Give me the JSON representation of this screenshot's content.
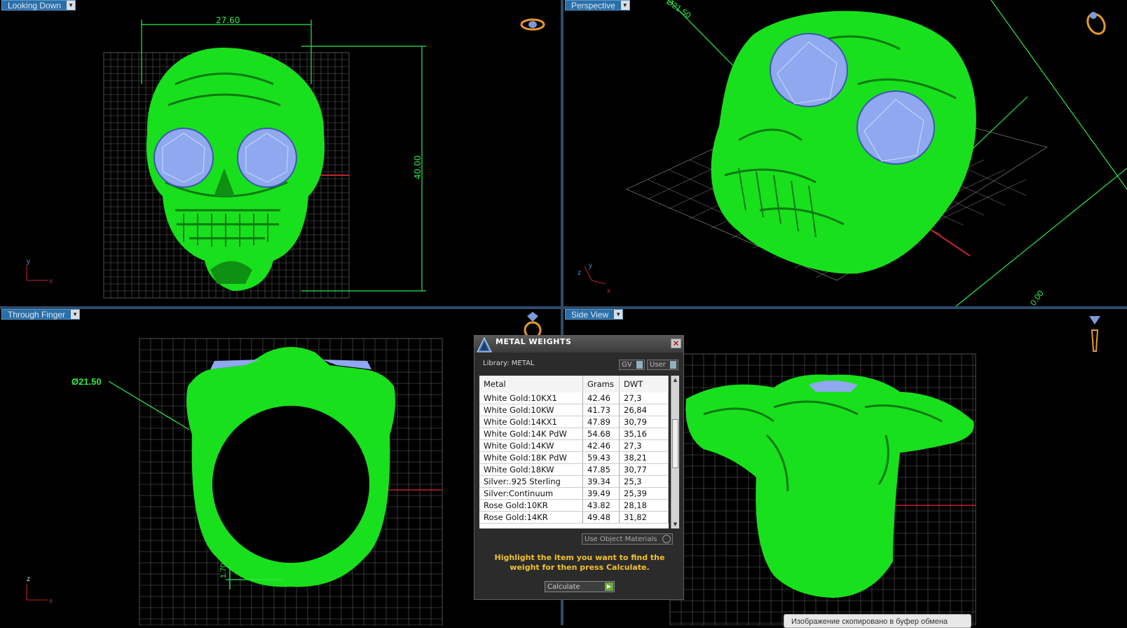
{
  "viewports": [
    {
      "id": "looking-down",
      "label": "Looking Down",
      "width_label": "27.60",
      "height_label": "40.00"
    },
    {
      "id": "perspective",
      "label": "Perspective",
      "dim_label": "Ø21.50",
      "dim_label2": "0.00"
    },
    {
      "id": "through-finger",
      "label": "Through Finger",
      "diameter_label": "Ø21.50",
      "thickness_label": "1.70"
    },
    {
      "id": "side-view",
      "label": "Side View"
    }
  ],
  "axes": {
    "x": "x",
    "y": "y",
    "z": "z"
  },
  "panel": {
    "title": "METAL WEIGHTS",
    "library_label": "Library: METAL",
    "gv_label": "GV",
    "user_label": "User",
    "columns": [
      "Metal",
      "Grams",
      "DWT"
    ],
    "rows": [
      {
        "metal": "White Gold:10KX1",
        "grams": "42.46",
        "dwt": "27,3"
      },
      {
        "metal": "White Gold:10KW",
        "grams": "41.73",
        "dwt": "26,84"
      },
      {
        "metal": "White Gold:14KX1",
        "grams": "47.89",
        "dwt": "30,79"
      },
      {
        "metal": "White Gold:14K PdW",
        "grams": "54.68",
        "dwt": "35,16"
      },
      {
        "metal": "White Gold:14KW",
        "grams": "42.46",
        "dwt": "27,3"
      },
      {
        "metal": "White Gold:18K PdW",
        "grams": "59.43",
        "dwt": "38,21"
      },
      {
        "metal": "White Gold:18KW",
        "grams": "47.85",
        "dwt": "30,77"
      },
      {
        "metal": "Silver:.925 Sterling",
        "grams": "39.34",
        "dwt": "25,3"
      },
      {
        "metal": "Silver:Continuum",
        "grams": "39.49",
        "dwt": "25,39"
      },
      {
        "metal": "Rose Gold:10KR",
        "grams": "43.82",
        "dwt": "28,18"
      },
      {
        "metal": "Rose Gold:14KR",
        "grams": "49.48",
        "dwt": "31,82"
      }
    ],
    "use_object_materials": "Use Object Materials",
    "hint": "Highlight the item you want to find the weight for then press Calculate.",
    "calculate_label": "Calculate"
  },
  "toast": "Изображение скопировано в буфер обмена",
  "colors": {
    "model": "#19e01d",
    "gem": "#8fa8ef",
    "grid": "#6a6a6a",
    "dimension": "#2fe84a",
    "tab": "#2a6fa8"
  }
}
